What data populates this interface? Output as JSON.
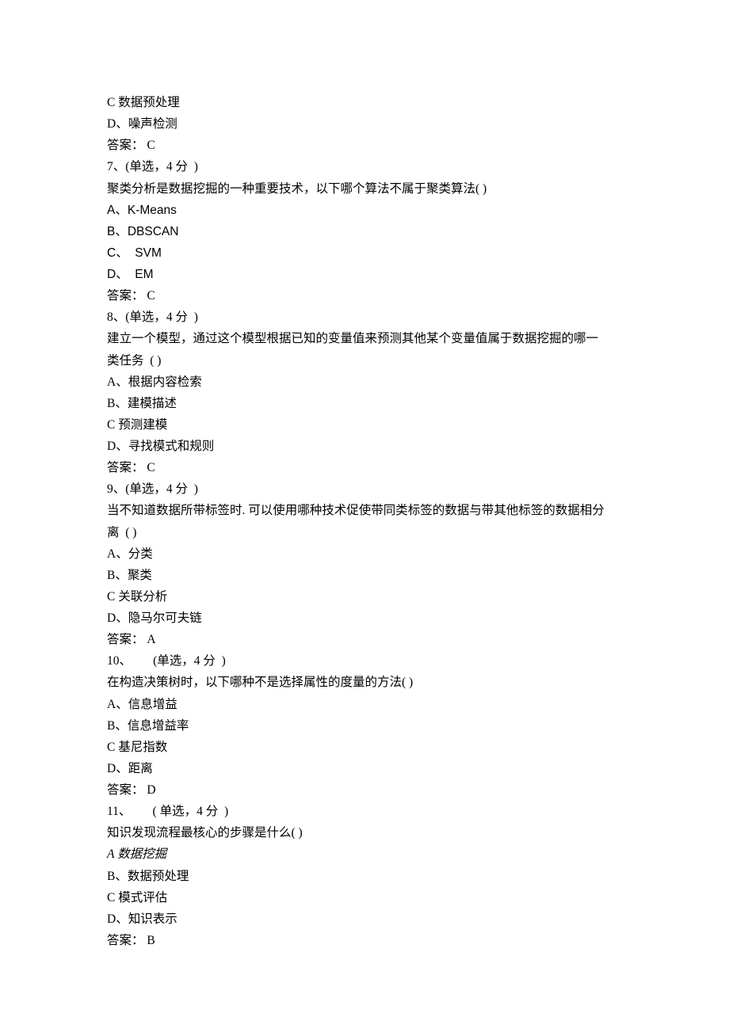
{
  "lines": [
    {
      "t": "C 数据预处理"
    },
    {
      "t": "D、噪声检测"
    },
    {
      "t": "答案： C"
    },
    {
      "t": "7、(单选，4 分  )"
    },
    {
      "t": "聚类分析是数据挖掘的一种重要技术，以下哪个算法不属于聚类算法( )"
    },
    {
      "t": "A、K-Means",
      "latin": true
    },
    {
      "t": "B、DBSCAN",
      "latin": true
    },
    {
      "t": "C、  SVM",
      "latin": true
    },
    {
      "t": "D、  EM",
      "latin": true
    },
    {
      "t": "答案： C"
    },
    {
      "t": "8、(单选，4 分  )"
    },
    {
      "t": "建立一个模型，通过这个模型根据已知的变量值来预测其他某个变量值属于数据挖掘的哪一"
    },
    {
      "t": "类任务  ( )"
    },
    {
      "t": "A、根据内容检索"
    },
    {
      "t": "B、建模描述"
    },
    {
      "t": "C 预测建模"
    },
    {
      "t": "D、寻找模式和规则"
    },
    {
      "t": "答案： C"
    },
    {
      "t": "9、(单选，4 分  )"
    },
    {
      "t": "当不知道数据所带标签时. 可以使用哪种技术促使带同类标签的数据与带其他标签的数据相分"
    },
    {
      "t": "离  ( )"
    },
    {
      "t": "A、分类"
    },
    {
      "t": "B、聚类"
    },
    {
      "t": "C 关联分析"
    },
    {
      "t": "D、隐马尔可夫链"
    },
    {
      "t": "答案： A"
    },
    {
      "t": "10、       (单选，4 分  )"
    },
    {
      "t": "在构造决策树时，以下哪种不是选择属性的度量的方法( )"
    },
    {
      "t": "A、信息增益"
    },
    {
      "t": "B、信息增益率"
    },
    {
      "t": "C 基尼指数"
    },
    {
      "t": "D、距离"
    },
    {
      "t": "答案： D"
    },
    {
      "t": "11、       ( 单选，4 分  )"
    },
    {
      "t": "知识发现流程最核心的步骤是什么( )"
    },
    {
      "t": "A 数据挖掘",
      "italic": true
    },
    {
      "t": "B、数据预处理"
    },
    {
      "t": "C 模式评估"
    },
    {
      "t": "D、知识表示"
    },
    {
      "t": "答案： B"
    }
  ]
}
